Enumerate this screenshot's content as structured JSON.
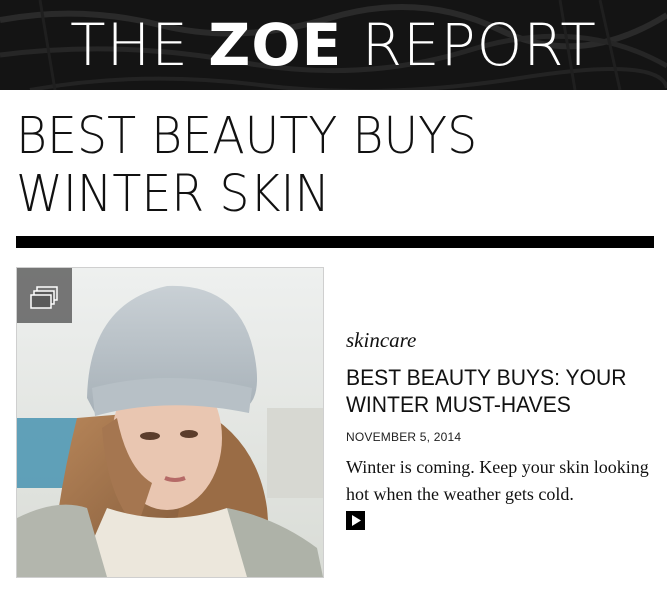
{
  "masthead": {
    "title_part1": "THE ",
    "title_part2": "ZOE",
    "title_part3": " REPORT"
  },
  "page": {
    "title_line1": "BEST BEAUTY BUYS",
    "title_line2": "WINTER SKIN"
  },
  "article": {
    "category": "skincare",
    "headline_line1": "BEST BEAUTY BUYS: YOUR",
    "headline_line2": "WINTER MUST-HAVES",
    "date": "NOVEMBER 5, 2014",
    "summary_line1": "Winter is coming. Keep your skin looking",
    "summary_line2": "hot when the weather gets cold.",
    "gallery_icon": "gallery-stack-icon",
    "play_icon": "play-icon"
  },
  "colors": {
    "masthead_bg": "#121212",
    "text": "#111111",
    "rule": "#000000",
    "badge": "#5a5a5a"
  }
}
